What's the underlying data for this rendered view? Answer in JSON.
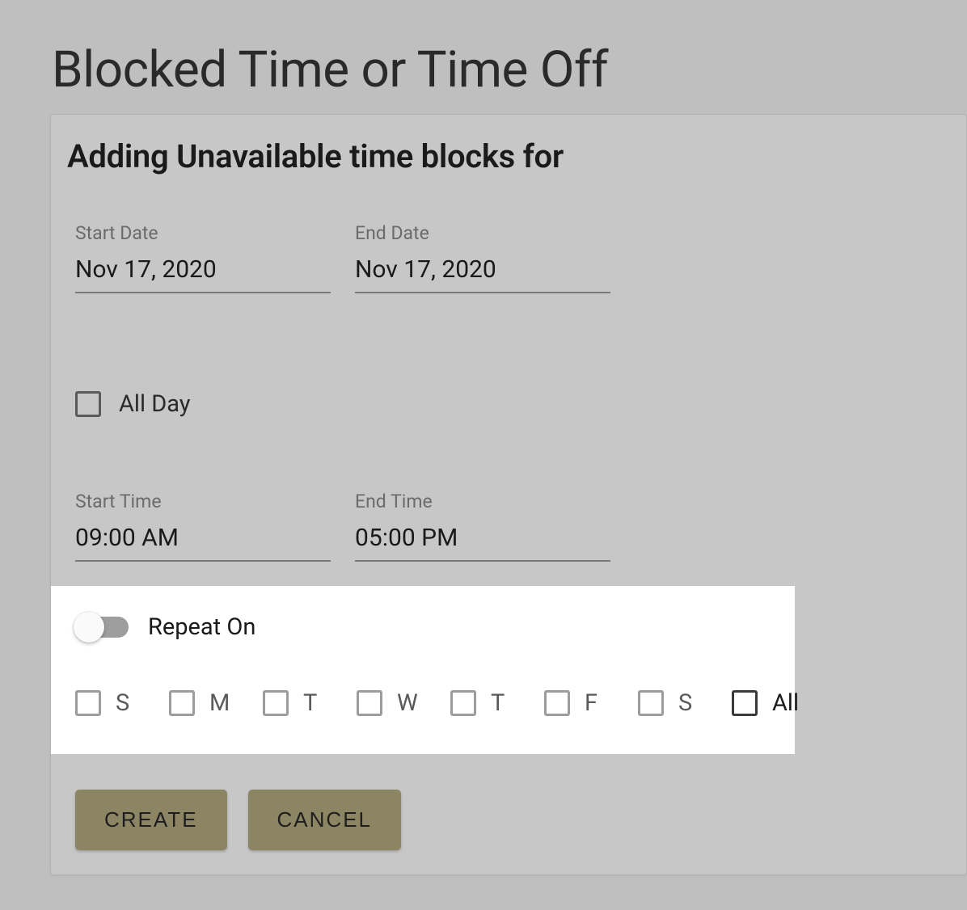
{
  "page_title": "Blocked Time or Time Off",
  "card_title": "Adding Unavailable time blocks for",
  "start_date": {
    "label": "Start Date",
    "value": "Nov 17, 2020"
  },
  "end_date": {
    "label": "End Date",
    "value": "Nov 17, 2020"
  },
  "all_day": {
    "label": "All Day",
    "checked": false
  },
  "start_time": {
    "label": "Start Time",
    "value": "09:00 AM"
  },
  "end_time": {
    "label": "End Time",
    "value": "05:00 PM"
  },
  "repeat": {
    "label": "Repeat On",
    "enabled": false
  },
  "days": {
    "sun": "S",
    "mon": "M",
    "tue": "T",
    "wed": "W",
    "thu": "T",
    "fri": "F",
    "sat": "S",
    "all": "All"
  },
  "buttons": {
    "create": "CREATE",
    "cancel": "CANCEL"
  }
}
